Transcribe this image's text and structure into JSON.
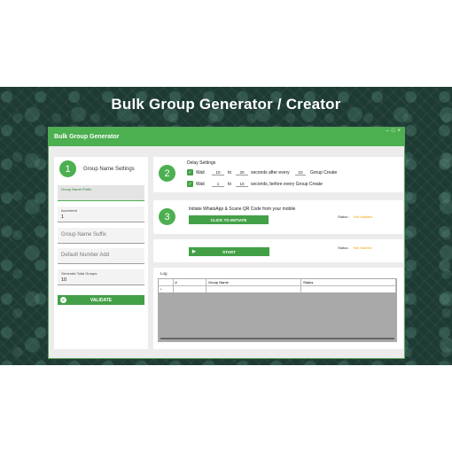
{
  "banner": {
    "title": "Bulk Group Generator / Creator"
  },
  "window": {
    "title": "Bulk Group Generator",
    "controls": {
      "minimize": "–",
      "maximize": "□",
      "close": "×"
    }
  },
  "left_panel": {
    "step": "1",
    "heading": "Group Name Settings",
    "fields": {
      "prefix": {
        "label": "Group Name Prefix"
      },
      "increment": {
        "label": "Increment",
        "value": "1"
      },
      "suffix": {
        "placeholder": "Group Name Suffix"
      },
      "default_number": {
        "placeholder": "Default Number Add"
      },
      "total_groups": {
        "label": "Generate Total Groups",
        "value": "10"
      }
    },
    "validate_label": "VALIDATE"
  },
  "delay": {
    "step": "2",
    "title": "Delay Settings",
    "row1": {
      "wait": "Wait",
      "from": "10",
      "to_label": "to",
      "to": "20",
      "after_every": "seconds after every",
      "count": "10",
      "suffix": "Group Create"
    },
    "row2": {
      "wait": "Wait",
      "from": "1",
      "to_label": "to",
      "to": "10",
      "suffix": "seconds, before every Group Create"
    }
  },
  "initiate": {
    "step": "3",
    "text": "Initiate WhatsApp & Scane QR Code from your mobile",
    "button": "CLICK TO INITIATE",
    "status_label": "Status :",
    "status_value": "Not Initiated"
  },
  "start": {
    "button": "START",
    "status_label": "Status :",
    "status_value": "Not Started"
  },
  "log": {
    "title": "Log",
    "columns": [
      "#",
      "Group Name",
      "Status"
    ],
    "row_marker": "*"
  },
  "colors": {
    "accent": "#4caf50",
    "status": "#f0a500",
    "banner_bg": "#1d3a33"
  }
}
